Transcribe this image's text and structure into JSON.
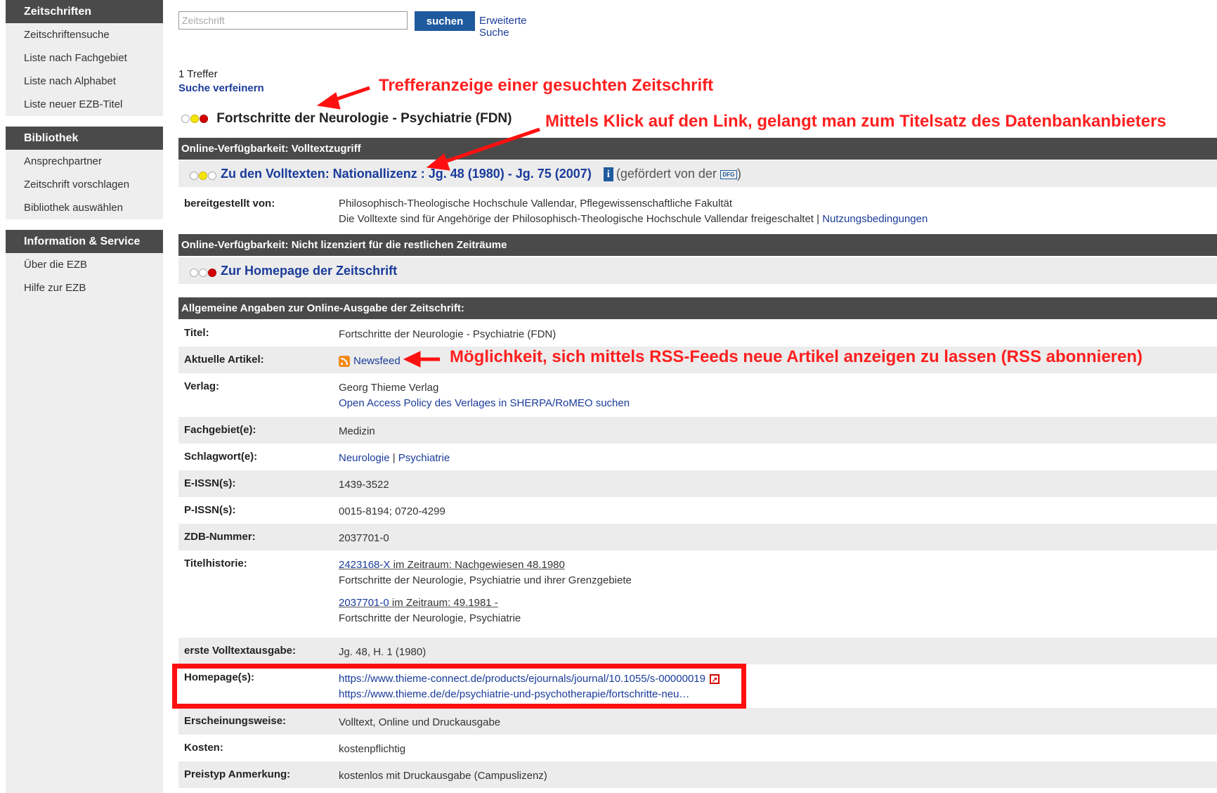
{
  "sidebar": {
    "sections": [
      {
        "heading": "Zeitschriften",
        "items": [
          "Zeitschriftensuche",
          "Liste nach Fachgebiet",
          "Liste nach Alphabet",
          "Liste neuer EZB-Titel"
        ]
      },
      {
        "heading": "Bibliothek",
        "items": [
          "Ansprechpartner",
          "Zeitschrift vorschlagen",
          "Bibliothek auswählen"
        ]
      },
      {
        "heading": "Information & Service",
        "items": [
          "Über die EZB",
          "Hilfe zur EZB"
        ]
      }
    ]
  },
  "search": {
    "placeholder": "Zeitschrift",
    "button_label": "suchen",
    "advanced_label": "Erweiterte Suche"
  },
  "results": {
    "count_text": "1 Treffer",
    "refine_label": "Suche verfeinern",
    "journal_title": "Fortschritte der Neurologie - Psychiatrie (FDN)"
  },
  "access": {
    "fulltext_bar": "Online-Verfügbarkeit: Volltextzugriff",
    "fulltext_link": "Zu den Volltexten: Nationallizenz : Jg. 48 (1980) - Jg. 75 (2007)",
    "funded_text": "(gefördert von der",
    "dfg_label": "DFG",
    "close_paren": ")",
    "provided_label": "bereitgestellt von:",
    "provided_by": "Philosophisch-Theologische Hochschule Vallendar, Pflegewissenschaftliche Fakultät",
    "provided_note": "Die Volltexte sind für Angehörige der Philosophisch-Theologische Hochschule Vallendar freigeschaltet |",
    "terms_link": "Nutzungsbedingungen",
    "unlicensed_bar": "Online-Verfügbarkeit: Nicht lizenziert für die restlichen Zeiträume",
    "homepage_link": "Zur Homepage der Zeitschrift"
  },
  "general": {
    "bar": "Allgemeine Angaben zur Online-Ausgabe der Zeitschrift:",
    "title_label": "Titel:",
    "title_value": "Fortschritte der Neurologie - Psychiatrie (FDN)",
    "articles_label": "Aktuelle Artikel:",
    "newsfeed_label": "Newsfeed",
    "publisher_label": "Verlag:",
    "publisher_value": "Georg Thieme Verlag",
    "sherpa_link": "Open Access Policy des Verlages in SHERPA/RoMEO suchen",
    "subject_label": "Fachgebiet(e):",
    "subject_value": "Medizin",
    "keywords_label": "Schlagwort(e):",
    "keyword_1": "Neurologie",
    "keyword_sep": "|",
    "keyword_2": "Psychiatrie",
    "eissn_label": "E-ISSN(s):",
    "eissn_value": "1439-3522",
    "pissn_label": "P-ISSN(s):",
    "pissn_value": "0015-8194; 0720-4299",
    "zdb_label": "ZDB-Nummer:",
    "zdb_value": "2037701-0",
    "history_label": "Titelhistorie:",
    "history_1_id": "2423168-X",
    "history_1_period": " im Zeitraum: Nachgewiesen 48.1980",
    "history_1_title": "Fortschritte der Neurologie, Psychiatrie und ihrer Grenzgebiete",
    "history_2_id": "2037701-0",
    "history_2_period": " im Zeitraum: 49.1981 -",
    "history_2_title": "Fortschritte der Neurologie, Psychiatrie",
    "first_issue_label": "erste Volltextausgabe:",
    "first_issue_value": "Jg. 48, H. 1 (1980)",
    "homepages_label": "Homepage(s):",
    "homepage_1": "https://www.thieme-connect.de/products/ejournals/journal/10.1055/s-00000019",
    "homepage_2": "https://www.thieme.de/de/psychiatrie-und-psychotherapie/fortschritte-neu…",
    "appearance_label": "Erscheinungsweise:",
    "appearance_value": "Volltext, Online und Druckausgabe",
    "costs_label": "Kosten:",
    "costs_value": "kostenpflichtig",
    "pricetype_label": "Preistyp Anmerkung:",
    "pricetype_value": "kostenlos mit Druckausgabe (Campuslizenz)"
  },
  "annotations": {
    "hit_display": "Trefferanzeige einer gesuchten Zeitschrift",
    "link_note": "Mittels Klick auf den Link, gelangt man zum Titelsatz des Datenbankanbieters",
    "rss_note": "Möglichkeit, sich mittels RSS-Feeds neue Artikel anzeigen zu lassen (RSS abonnieren)",
    "color": "#ff1f1f"
  },
  "colors": {
    "bar_bg": "#4a4a4a",
    "button_bg": "#1f5a9e",
    "link": "#1a3c9a",
    "row_alt": "#ececec",
    "highlight_box": "#ff1010"
  },
  "icons": [
    "traffic-light-dots",
    "info-icon",
    "dfg-logo",
    "rss-icon",
    "external-link-icon"
  ]
}
